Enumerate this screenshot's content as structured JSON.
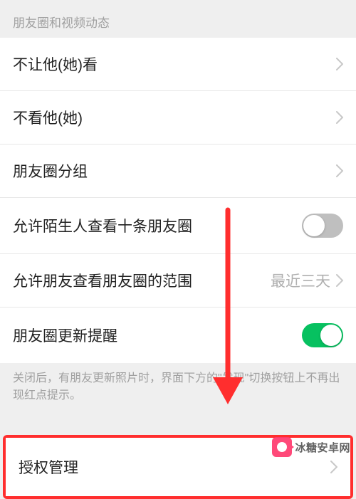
{
  "section_header": "朋友圈和视频动态",
  "rows": {
    "dont_let_see": "不让他(她)看",
    "dont_see": "不看他(她)",
    "groups": "朋友圈分组",
    "allow_strangers": "允许陌生人查看十条朋友圈",
    "allow_friends_range": "允许朋友查看朋友圈的范围",
    "allow_friends_range_value": "最近三天",
    "update_reminder": "朋友圈更新提醒",
    "auth_management": "授权管理"
  },
  "footer_note": "关闭后，有朋友更新照片时，界面下方的\"发现\"切换按钮上不再出现红点提示。",
  "watermark": "冰糖安卓网",
  "colors": {
    "highlight": "#ff2e2e",
    "toggle_on": "#07c160",
    "toggle_off": "#bfbfbf"
  }
}
